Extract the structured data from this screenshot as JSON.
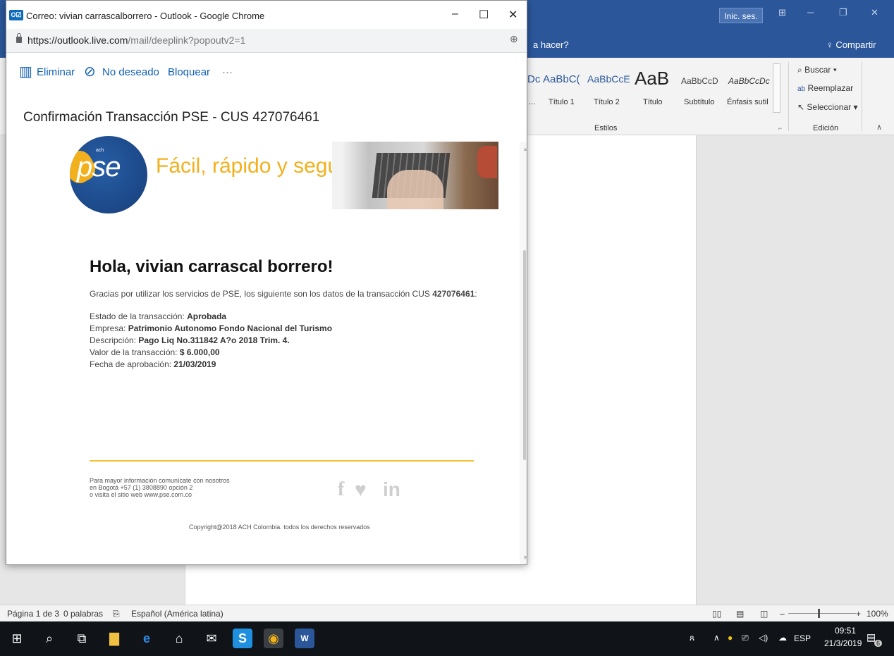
{
  "word": {
    "signin_label": "Inic. ses.",
    "tellme_text": "a hacer?",
    "share_label": "Compartir",
    "styles": [
      {
        "sample": "Dc",
        "name": "..."
      },
      {
        "sample": "AaBbC(",
        "name": "Título 1"
      },
      {
        "sample": "AaBbCcE",
        "name": "Título 2"
      },
      {
        "sample": "AaB",
        "name": "Título"
      },
      {
        "sample": "AaBbCcD",
        "name": "Subtítulo"
      },
      {
        "sample": "AaBbCcDc",
        "name": "Énfasis sutil"
      }
    ],
    "styles_group_label": "Estilos",
    "editing_group_label": "Edición",
    "editing": {
      "find": "Buscar",
      "replace": "Reemplazar",
      "select": "Seleccionar"
    },
    "status": {
      "page": "Página 1 de 3",
      "words": "0 palabras",
      "language": "Español (América latina)",
      "zoom": "100%"
    }
  },
  "taskbar": {
    "lang": "ESP",
    "time": "09:51",
    "date": "21/3/2019",
    "notifications": "6"
  },
  "popup": {
    "window_title": "Correo: vivian carrascalborrero - Outlook - Google Chrome",
    "app_logo": "O☑",
    "url_prefix": "https://outlook.live.com",
    "url_path": "/mail/deeplink?popoutv2=1",
    "toolbar": {
      "delete": "Eliminar",
      "junk": "No deseado",
      "block": "Bloquear",
      "more": "···"
    },
    "subject": "Confirmación Transacción PSE - CUS 427076461"
  },
  "email": {
    "brand": "pse",
    "brand_small": "ach",
    "slogan": "Fácil, rápido y seguro",
    "greeting": "Hola, vivian carrascal borrero!",
    "intro_text": "Gracias por utilizar los servicios de PSE, los siguiente son los datos de la transacción CUS ",
    "intro_cus": "427076461",
    "intro_end": ":",
    "details": [
      {
        "label": "Estado de la transacción: ",
        "value": "Aprobada"
      },
      {
        "label": "Empresa: ",
        "value": "Patrimonio Autonomo Fondo Nacional del Turismo"
      },
      {
        "label": "Descripción: ",
        "value": "Pago Liq No.311842 A?o 2018 Trim. 4."
      },
      {
        "label": "Valor de la transacción: ",
        "value": "$ 6.000,00"
      },
      {
        "label": "Fecha de aprobación: ",
        "value": "21/03/2019"
      }
    ],
    "footer": {
      "line1": "Para mayor información comunícate con nosotros",
      "line2": "en Bogotá +57 (1) 3808890 opción 2",
      "line3": "o visita el sitio web www.pse.com.co"
    },
    "copyright": "Copyright@2018 ACH Colombia. todos los derechos reservados"
  }
}
